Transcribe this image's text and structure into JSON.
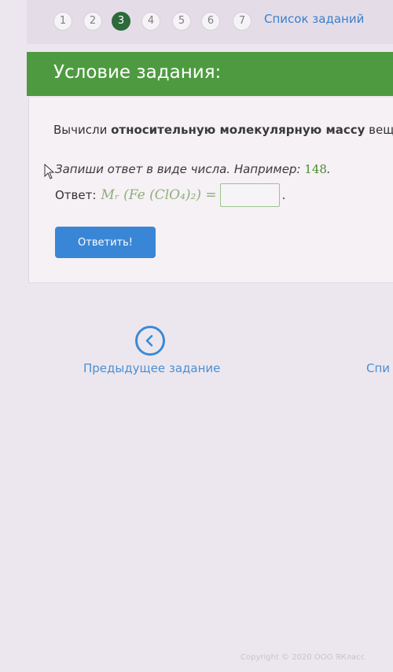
{
  "nav": {
    "pages": [
      "1",
      "2",
      "3",
      "4",
      "5",
      "6",
      "7"
    ],
    "active_page": "3",
    "task_list_label": "Список заданий"
  },
  "header": {
    "title": "Условие задания:"
  },
  "task": {
    "question_prefix": "Вычисли ",
    "question_strong": "относительную молекулярную массу",
    "question_suffix": " вещ",
    "hint_text": "Запиши ответ в виде числа. Например: ",
    "hint_number": "148",
    "hint_end": ".",
    "answer_label": "Ответ:",
    "formula": "Mᵣ (Fe (ClO₄)₂) =",
    "answer_value": "",
    "answer_end": ".",
    "submit_label": "Ответить!"
  },
  "navigation": {
    "prev_label": "Предыдущее задание",
    "next_label": "Спи"
  },
  "footer": {
    "copyright": "Copyright © 2020 ООО ЯКласс"
  },
  "colors": {
    "header_bg": "#4e9a40",
    "active_page_bg": "#2c6a3a",
    "link": "#3b7fc9",
    "button_bg": "#3a86d6"
  },
  "icons": {
    "prev": "chevron-left-circle-icon",
    "cursor": "mouse-pointer-icon"
  }
}
